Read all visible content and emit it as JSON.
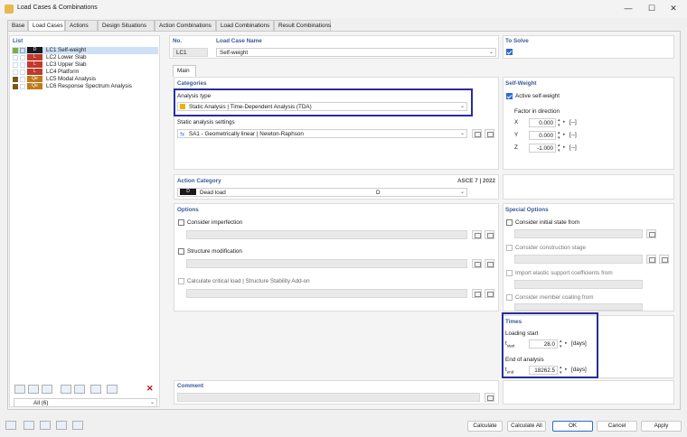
{
  "window": {
    "title": "Load Cases & Combinations"
  },
  "tabs": [
    "Base",
    "Load Cases",
    "Actions",
    "Design Situations",
    "Action Combinations",
    "Load Combinations",
    "Result Combinations"
  ],
  "list": {
    "header": "List",
    "items": [
      {
        "id": "LC1",
        "name": "Self-weight",
        "badge": "D",
        "color": "#1a1a1a",
        "swatch": "#7fae3f"
      },
      {
        "id": "LC2",
        "name": "Lower Slab",
        "badge": "L",
        "color": "#c0392b",
        "swatch": ""
      },
      {
        "id": "LC3",
        "name": "Upper Slab",
        "badge": "L",
        "color": "#c0392b",
        "swatch": ""
      },
      {
        "id": "LC4",
        "name": "Platform",
        "badge": "L",
        "color": "#c0392b",
        "swatch": ""
      },
      {
        "id": "LC5",
        "name": "Modal Analysis",
        "badge": "Qe",
        "color": "#c07a1a",
        "swatch": "#7a5a1a"
      },
      {
        "id": "LC6",
        "name": "Response Spectrum Analysis",
        "badge": "Qe",
        "color": "#c07a1a",
        "swatch": "#7a5a1a"
      }
    ],
    "filter": "All (6)"
  },
  "no": {
    "label": "No.",
    "value": "LC1"
  },
  "load_case_name": {
    "label": "Load Case Name",
    "value": "Self-weight"
  },
  "to_solve": {
    "label": "To Solve"
  },
  "main_tab": "Main",
  "categories": {
    "head": "Categories",
    "analysis_type_label": "Analysis type",
    "analysis_type_value": "Static Analysis | Time-Dependent Analysis (TDA)",
    "static_settings_label": "Static analysis settings",
    "static_settings_value": "SA1 - Geometrically linear | Newton-Raphson"
  },
  "self_weight": {
    "head": "Self-Weight",
    "active_label": "Active self-weight",
    "factor_label": "Factor in direction",
    "rows": [
      {
        "axis": "X",
        "value": "0.000",
        "unit": "[--]"
      },
      {
        "axis": "Y",
        "value": "0.000",
        "unit": "[--]"
      },
      {
        "axis": "Z",
        "value": "-1.000",
        "unit": "[--]"
      }
    ]
  },
  "action_category": {
    "head": "Action Category",
    "code": "ASCE 7 | 2022",
    "badge": "D",
    "name": "Dead load",
    "value": "D"
  },
  "options": {
    "head": "Options",
    "imperfection": "Consider imperfection",
    "modification": "Structure modification",
    "critical": "Calculate critical load | Structure Stability Add-on"
  },
  "special": {
    "head": "Special Options",
    "initial": "Consider initial state from",
    "construction": "Consider construction stage",
    "elastic": "Import elastic support coefficients from",
    "coating": "Consider member coating from"
  },
  "times": {
    "head": "Times",
    "loading_start_label": "Loading start",
    "t_start_sym": "t",
    "t_start_sub": "start",
    "t_start_value": "28.0",
    "t_start_unit": "[days]",
    "end_label": "End of analysis",
    "t_end_sym": "t",
    "t_end_sub": "end",
    "t_end_value": "18262.5",
    "t_end_unit": "[days]"
  },
  "comment": {
    "head": "Comment"
  },
  "buttons": {
    "calculate": "Calculate",
    "calculate_all": "Calculate All",
    "ok": "OK",
    "cancel": "Cancel",
    "apply": "Apply"
  }
}
